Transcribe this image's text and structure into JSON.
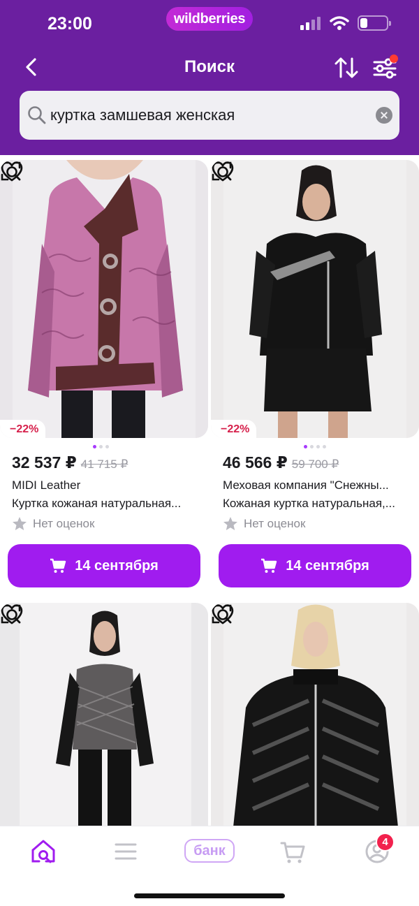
{
  "status_bar": {
    "time": "23:00",
    "brand": "wildberries"
  },
  "header": {
    "title": "Поиск"
  },
  "search": {
    "query": "куртка замшевая женская"
  },
  "products": [
    {
      "discount": "−22%",
      "price": "32 537 ₽",
      "old_price": "41 715 ₽",
      "brand": "MIDI Leather",
      "title": "Куртка кожаная натуральная...",
      "rating": "Нет оценок",
      "delivery": "14 сентября"
    },
    {
      "discount": "−22%",
      "price": "46 566 ₽",
      "old_price": "59 700 ₽",
      "brand": "Меховая компания \"Снежны...",
      "title": "Кожаная куртка натуральная,...",
      "rating": "Нет оценок",
      "delivery": "14 сентября"
    }
  ],
  "tabbar": {
    "bank_label": "банк",
    "profile_badge": "4"
  },
  "colors": {
    "header": "#6b1fa0",
    "accent": "#a01cef",
    "discount": "#d6204b"
  },
  "icons": [
    "back-chevron-icon",
    "sort-icon",
    "filter-icon",
    "search-icon",
    "clear-icon",
    "visual-search-icon",
    "heart-icon",
    "star-icon",
    "cart-icon",
    "home-search-icon",
    "catalog-icon",
    "profile-icon"
  ]
}
